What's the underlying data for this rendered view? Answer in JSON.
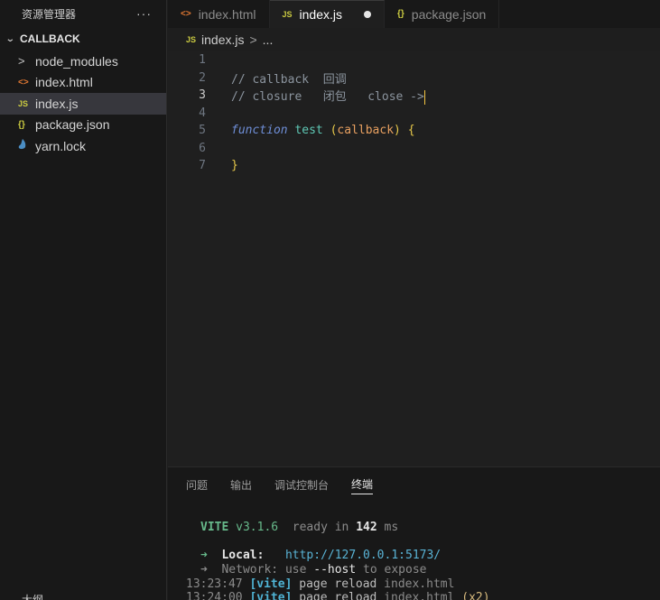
{
  "sidebar": {
    "title": "资源管理器",
    "more": "···",
    "folder": "CALLBACK",
    "items": [
      {
        "icon": "chevron-right-icon",
        "glyph": ">",
        "label": "node_modules"
      },
      {
        "icon": "html-file-icon",
        "glyph": "<>",
        "label": "index.html"
      },
      {
        "icon": "js-file-icon",
        "glyph": "JS",
        "label": "index.js"
      },
      {
        "icon": "json-file-icon",
        "glyph": "{}",
        "label": "package.json"
      },
      {
        "icon": "yarn-file-icon",
        "glyph": "🐈",
        "label": "yarn.lock"
      }
    ],
    "bottom_section": "大纲"
  },
  "tabs": [
    {
      "glyph": "<>",
      "label": "index.html"
    },
    {
      "glyph": "JS",
      "label": "index.js"
    },
    {
      "glyph": "{}",
      "label": "package.json"
    }
  ],
  "breadcrumb": {
    "glyph": "JS",
    "file": "index.js",
    "sep": ">",
    "more": "..."
  },
  "editor": {
    "line_numbers": [
      "1",
      "2",
      "3",
      "4",
      "5",
      "6",
      "7"
    ],
    "line2": "// callback  回调",
    "line3": "// closure   闭包   close ->",
    "line5": {
      "kw": "function",
      "name": "test",
      "open": "(",
      "param": "callback",
      "close": ")",
      "brace": "{"
    },
    "line7": "}"
  },
  "panel": {
    "tabs": [
      "问题",
      "输出",
      "调试控制台",
      "终端"
    ],
    "terminal": {
      "vite": "VITE",
      "version": "v3.1.6",
      "ready": "ready in",
      "ready_ms": "142",
      "ms": "ms",
      "arrow": "➜",
      "local_label": "Local:",
      "local_url": "http://127.0.0.1:5173/",
      "network_label": "Network:",
      "network_use": "use",
      "network_flag": "--host",
      "network_rest": "to expose",
      "log1_time": "13:23:47",
      "log1_tag": "[vite]",
      "log1_msg": "page reload",
      "log1_file": "index.html",
      "log2_time": "13:24:00",
      "log2_tag": "[vite]",
      "log2_msg": "page reload",
      "log2_file": "index.html",
      "log2_count": "(x2)"
    }
  },
  "colors": {
    "accent_js": "#cbcb41",
    "accent_html": "#e37933",
    "vite_green": "#67b98b"
  }
}
